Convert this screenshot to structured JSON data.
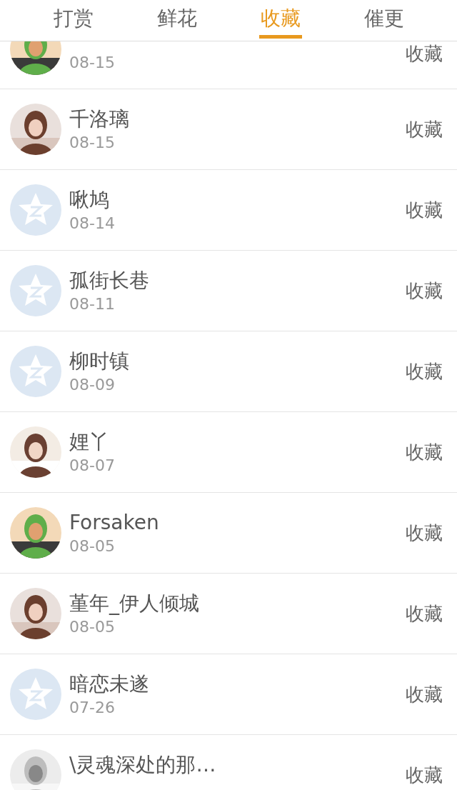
{
  "tabs": [
    {
      "label": "打赏",
      "selected": false
    },
    {
      "label": "鲜花",
      "selected": false
    },
    {
      "label": "收藏",
      "selected": true
    },
    {
      "label": "催更",
      "selected": false
    }
  ],
  "rows": [
    {
      "date": "08-15",
      "action": "收藏"
    },
    {
      "name": "千洛璃",
      "date": "08-15",
      "action": "收藏"
    },
    {
      "avatar": {
        "kind": "default"
      },
      "name": "啾鸠",
      "date": "08-14",
      "action": "收藏"
    },
    {
      "avatar": {
        "kind": "default"
      },
      "name": "孤街长巷",
      "date": "08-11",
      "action": "收藏"
    },
    {
      "avatar": {
        "kind": "default"
      },
      "name": "柳时镇",
      "date": "08-09",
      "action": "收藏"
    },
    {
      "name": "娌丫",
      "date": "08-07",
      "action": "收藏"
    },
    {
      "name": "Forsaken",
      "date": "08-05",
      "action": "收藏"
    },
    {
      "name": "堇年_伊人倾城",
      "date": "08-05",
      "action": "收藏"
    },
    {
      "avatar": {
        "kind": "default"
      },
      "name": "暗恋未遂",
      "date": "07-26",
      "action": "收藏"
    },
    {
      "name": "\\灵魂深处的那…",
      "action": "收藏"
    }
  ]
}
